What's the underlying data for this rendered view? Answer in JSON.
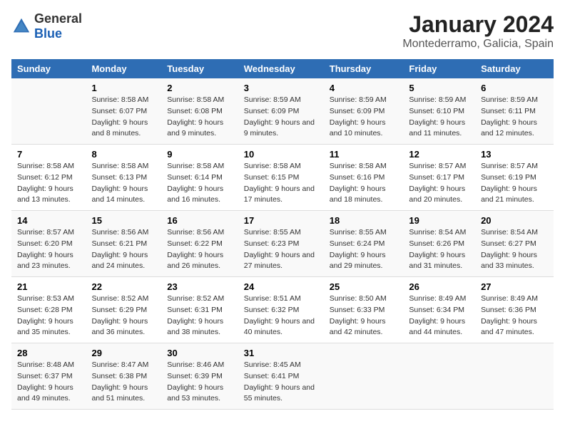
{
  "logo": {
    "general": "General",
    "blue": "Blue"
  },
  "title": "January 2024",
  "subtitle": "Montederramo, Galicia, Spain",
  "weekdays": [
    "Sunday",
    "Monday",
    "Tuesday",
    "Wednesday",
    "Thursday",
    "Friday",
    "Saturday"
  ],
  "weeks": [
    [
      {
        "day": "",
        "sunrise": "",
        "sunset": "",
        "daylight": ""
      },
      {
        "day": "1",
        "sunrise": "Sunrise: 8:58 AM",
        "sunset": "Sunset: 6:07 PM",
        "daylight": "Daylight: 9 hours and 8 minutes."
      },
      {
        "day": "2",
        "sunrise": "Sunrise: 8:58 AM",
        "sunset": "Sunset: 6:08 PM",
        "daylight": "Daylight: 9 hours and 9 minutes."
      },
      {
        "day": "3",
        "sunrise": "Sunrise: 8:59 AM",
        "sunset": "Sunset: 6:09 PM",
        "daylight": "Daylight: 9 hours and 9 minutes."
      },
      {
        "day": "4",
        "sunrise": "Sunrise: 8:59 AM",
        "sunset": "Sunset: 6:09 PM",
        "daylight": "Daylight: 9 hours and 10 minutes."
      },
      {
        "day": "5",
        "sunrise": "Sunrise: 8:59 AM",
        "sunset": "Sunset: 6:10 PM",
        "daylight": "Daylight: 9 hours and 11 minutes."
      },
      {
        "day": "6",
        "sunrise": "Sunrise: 8:59 AM",
        "sunset": "Sunset: 6:11 PM",
        "daylight": "Daylight: 9 hours and 12 minutes."
      }
    ],
    [
      {
        "day": "7",
        "sunrise": "Sunrise: 8:58 AM",
        "sunset": "Sunset: 6:12 PM",
        "daylight": "Daylight: 9 hours and 13 minutes."
      },
      {
        "day": "8",
        "sunrise": "Sunrise: 8:58 AM",
        "sunset": "Sunset: 6:13 PM",
        "daylight": "Daylight: 9 hours and 14 minutes."
      },
      {
        "day": "9",
        "sunrise": "Sunrise: 8:58 AM",
        "sunset": "Sunset: 6:14 PM",
        "daylight": "Daylight: 9 hours and 16 minutes."
      },
      {
        "day": "10",
        "sunrise": "Sunrise: 8:58 AM",
        "sunset": "Sunset: 6:15 PM",
        "daylight": "Daylight: 9 hours and 17 minutes."
      },
      {
        "day": "11",
        "sunrise": "Sunrise: 8:58 AM",
        "sunset": "Sunset: 6:16 PM",
        "daylight": "Daylight: 9 hours and 18 minutes."
      },
      {
        "day": "12",
        "sunrise": "Sunrise: 8:57 AM",
        "sunset": "Sunset: 6:17 PM",
        "daylight": "Daylight: 9 hours and 20 minutes."
      },
      {
        "day": "13",
        "sunrise": "Sunrise: 8:57 AM",
        "sunset": "Sunset: 6:19 PM",
        "daylight": "Daylight: 9 hours and 21 minutes."
      }
    ],
    [
      {
        "day": "14",
        "sunrise": "Sunrise: 8:57 AM",
        "sunset": "Sunset: 6:20 PM",
        "daylight": "Daylight: 9 hours and 23 minutes."
      },
      {
        "day": "15",
        "sunrise": "Sunrise: 8:56 AM",
        "sunset": "Sunset: 6:21 PM",
        "daylight": "Daylight: 9 hours and 24 minutes."
      },
      {
        "day": "16",
        "sunrise": "Sunrise: 8:56 AM",
        "sunset": "Sunset: 6:22 PM",
        "daylight": "Daylight: 9 hours and 26 minutes."
      },
      {
        "day": "17",
        "sunrise": "Sunrise: 8:55 AM",
        "sunset": "Sunset: 6:23 PM",
        "daylight": "Daylight: 9 hours and 27 minutes."
      },
      {
        "day": "18",
        "sunrise": "Sunrise: 8:55 AM",
        "sunset": "Sunset: 6:24 PM",
        "daylight": "Daylight: 9 hours and 29 minutes."
      },
      {
        "day": "19",
        "sunrise": "Sunrise: 8:54 AM",
        "sunset": "Sunset: 6:26 PM",
        "daylight": "Daylight: 9 hours and 31 minutes."
      },
      {
        "day": "20",
        "sunrise": "Sunrise: 8:54 AM",
        "sunset": "Sunset: 6:27 PM",
        "daylight": "Daylight: 9 hours and 33 minutes."
      }
    ],
    [
      {
        "day": "21",
        "sunrise": "Sunrise: 8:53 AM",
        "sunset": "Sunset: 6:28 PM",
        "daylight": "Daylight: 9 hours and 35 minutes."
      },
      {
        "day": "22",
        "sunrise": "Sunrise: 8:52 AM",
        "sunset": "Sunset: 6:29 PM",
        "daylight": "Daylight: 9 hours and 36 minutes."
      },
      {
        "day": "23",
        "sunrise": "Sunrise: 8:52 AM",
        "sunset": "Sunset: 6:31 PM",
        "daylight": "Daylight: 9 hours and 38 minutes."
      },
      {
        "day": "24",
        "sunrise": "Sunrise: 8:51 AM",
        "sunset": "Sunset: 6:32 PM",
        "daylight": "Daylight: 9 hours and 40 minutes."
      },
      {
        "day": "25",
        "sunrise": "Sunrise: 8:50 AM",
        "sunset": "Sunset: 6:33 PM",
        "daylight": "Daylight: 9 hours and 42 minutes."
      },
      {
        "day": "26",
        "sunrise": "Sunrise: 8:49 AM",
        "sunset": "Sunset: 6:34 PM",
        "daylight": "Daylight: 9 hours and 44 minutes."
      },
      {
        "day": "27",
        "sunrise": "Sunrise: 8:49 AM",
        "sunset": "Sunset: 6:36 PM",
        "daylight": "Daylight: 9 hours and 47 minutes."
      }
    ],
    [
      {
        "day": "28",
        "sunrise": "Sunrise: 8:48 AM",
        "sunset": "Sunset: 6:37 PM",
        "daylight": "Daylight: 9 hours and 49 minutes."
      },
      {
        "day": "29",
        "sunrise": "Sunrise: 8:47 AM",
        "sunset": "Sunset: 6:38 PM",
        "daylight": "Daylight: 9 hours and 51 minutes."
      },
      {
        "day": "30",
        "sunrise": "Sunrise: 8:46 AM",
        "sunset": "Sunset: 6:39 PM",
        "daylight": "Daylight: 9 hours and 53 minutes."
      },
      {
        "day": "31",
        "sunrise": "Sunrise: 8:45 AM",
        "sunset": "Sunset: 6:41 PM",
        "daylight": "Daylight: 9 hours and 55 minutes."
      },
      {
        "day": "",
        "sunrise": "",
        "sunset": "",
        "daylight": ""
      },
      {
        "day": "",
        "sunrise": "",
        "sunset": "",
        "daylight": ""
      },
      {
        "day": "",
        "sunrise": "",
        "sunset": "",
        "daylight": ""
      }
    ]
  ]
}
